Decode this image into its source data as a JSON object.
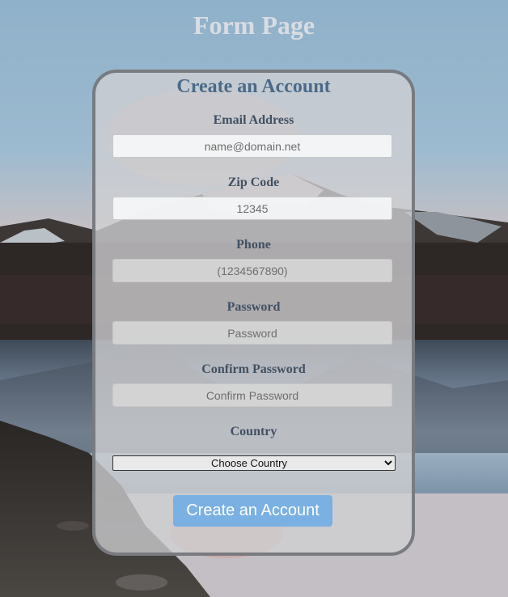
{
  "page": {
    "title": "Form Page"
  },
  "form": {
    "title": "Create an Account",
    "fields": [
      {
        "label": "Email Address",
        "placeholder": "name@domain.net"
      },
      {
        "label": "Zip Code",
        "placeholder": "12345"
      },
      {
        "label": "Phone",
        "placeholder": "(1234567890)"
      },
      {
        "label": "Password",
        "placeholder": "Password"
      },
      {
        "label": "Confirm Password",
        "placeholder": "Confirm Password"
      }
    ],
    "country": {
      "label": "Country",
      "selected": "Choose Country"
    },
    "submit_label": "Create an Account"
  },
  "colors": {
    "card_title": "#4a6a8a",
    "label": "#405063",
    "button": "#7ab0e2",
    "card_border": "#787b80"
  }
}
